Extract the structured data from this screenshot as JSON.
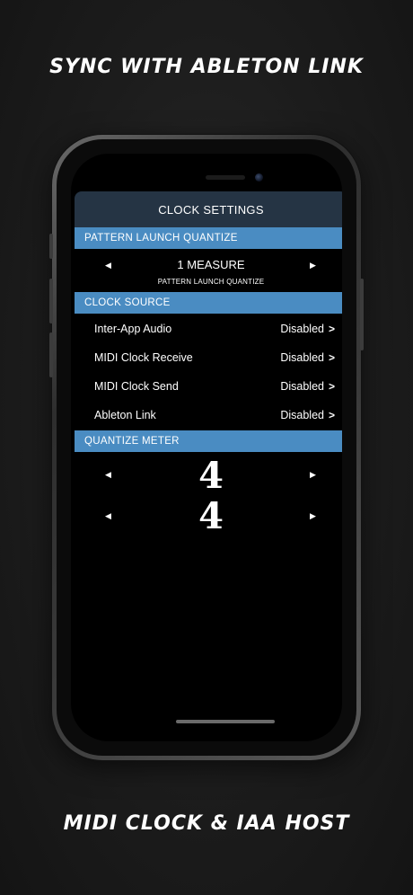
{
  "promo": {
    "headline_top": "SYNC WITH ABLETON LINK",
    "headline_bottom": "MIDI CLOCK & IAA HOST"
  },
  "screen": {
    "title": "CLOCK SETTINGS",
    "pattern_launch": {
      "header": "PATTERN LAUNCH QUANTIZE",
      "value": "1 MEASURE",
      "sublabel": "PATTERN LAUNCH QUANTIZE",
      "left_arrow": "◀",
      "right_arrow": "▶"
    },
    "clock_source": {
      "header": "CLOCK SOURCE",
      "rows": [
        {
          "label": "Inter-App Audio",
          "value": "Disabled",
          "chevron": ">"
        },
        {
          "label": "MIDI Clock Receive",
          "value": "Disabled",
          "chevron": ">"
        },
        {
          "label": "MIDI Clock Send",
          "value": "Disabled",
          "chevron": ">"
        },
        {
          "label": "Ableton Link",
          "value": "Disabled",
          "chevron": ">"
        }
      ]
    },
    "quantize_meter": {
      "header": "QUANTIZE METER",
      "numerator": "4",
      "denominator": "4",
      "left_arrow": "◀",
      "right_arrow": "▶"
    }
  },
  "colors": {
    "section_header": "#4a8cc2",
    "title_bar": "#253444"
  },
  "icons": {
    "arrow_left": "triangle-left-icon",
    "arrow_right": "triangle-right-icon",
    "chevron": "chevron-right-icon"
  }
}
